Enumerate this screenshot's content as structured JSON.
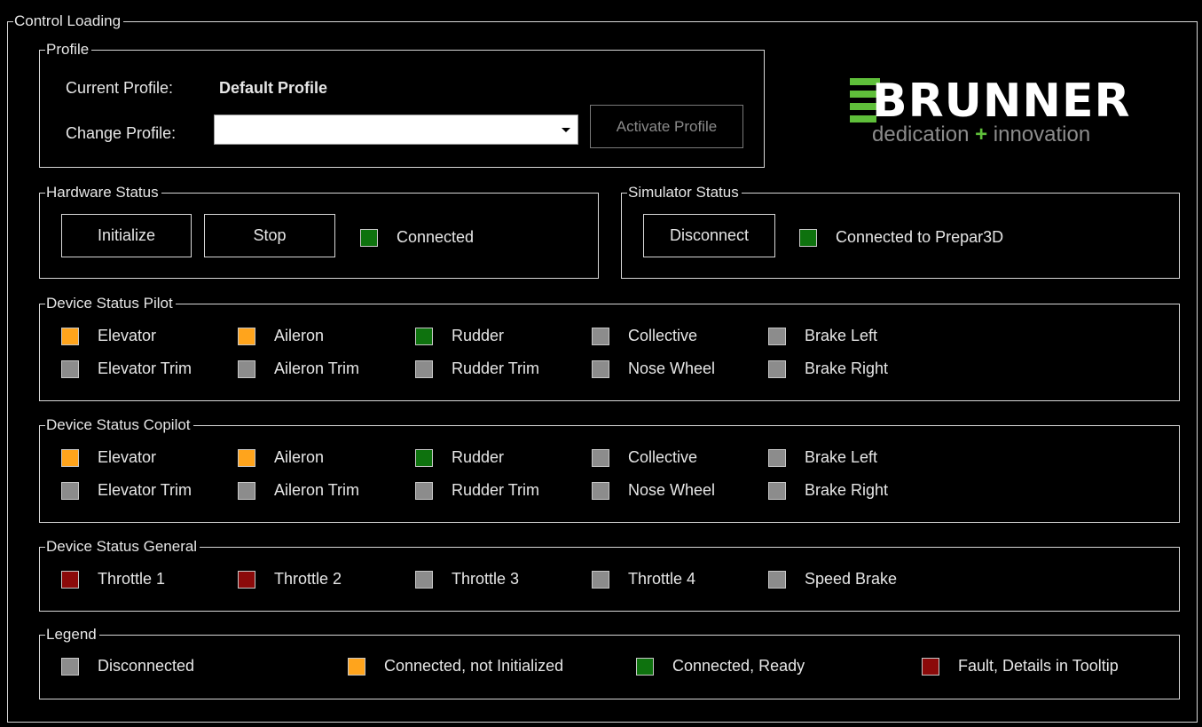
{
  "colors": {
    "disconnected": "#8c8c8c",
    "not_initialized": "#ffa41c",
    "ready": "#0e720e",
    "fault": "#8b0a0a",
    "brand_green": "#5fbf3a"
  },
  "main_group": {
    "title": "Control Loading"
  },
  "profile": {
    "title": "Profile",
    "current_label": "Current Profile:",
    "current_value": "Default Profile",
    "change_label": "Change Profile:",
    "select_value": "",
    "activate_button": "Activate Profile"
  },
  "logo": {
    "brand": "BRUNNER",
    "tagline_left": "dedication",
    "tagline_plus": "+",
    "tagline_right": "innovation"
  },
  "hardware": {
    "title": "Hardware Status",
    "initialize_button": "Initialize",
    "stop_button": "Stop",
    "status_label": "Connected",
    "status": "ready"
  },
  "simulator": {
    "title": "Simulator Status",
    "disconnect_button": "Disconnect",
    "status_label": "Connected to Prepar3D",
    "status": "ready"
  },
  "pilot": {
    "title": "Device Status Pilot",
    "devices": [
      {
        "label": "Elevator",
        "status": "not_initialized"
      },
      {
        "label": "Aileron",
        "status": "not_initialized"
      },
      {
        "label": "Rudder",
        "status": "ready"
      },
      {
        "label": "Collective",
        "status": "disconnected"
      },
      {
        "label": "Brake Left",
        "status": "disconnected"
      },
      {
        "label": "Elevator Trim",
        "status": "disconnected"
      },
      {
        "label": "Aileron Trim",
        "status": "disconnected"
      },
      {
        "label": "Rudder Trim",
        "status": "disconnected"
      },
      {
        "label": "Nose Wheel",
        "status": "disconnected"
      },
      {
        "label": "Brake Right",
        "status": "disconnected"
      }
    ]
  },
  "copilot": {
    "title": "Device Status Copilot",
    "devices": [
      {
        "label": "Elevator",
        "status": "not_initialized"
      },
      {
        "label": "Aileron",
        "status": "not_initialized"
      },
      {
        "label": "Rudder",
        "status": "ready"
      },
      {
        "label": "Collective",
        "status": "disconnected"
      },
      {
        "label": "Brake Left",
        "status": "disconnected"
      },
      {
        "label": "Elevator Trim",
        "status": "disconnected"
      },
      {
        "label": "Aileron Trim",
        "status": "disconnected"
      },
      {
        "label": "Rudder Trim",
        "status": "disconnected"
      },
      {
        "label": "Nose Wheel",
        "status": "disconnected"
      },
      {
        "label": "Brake Right",
        "status": "disconnected"
      }
    ]
  },
  "general": {
    "title": "Device Status General",
    "devices": [
      {
        "label": "Throttle 1",
        "status": "fault"
      },
      {
        "label": "Throttle 2",
        "status": "fault"
      },
      {
        "label": "Throttle 3",
        "status": "disconnected"
      },
      {
        "label": "Throttle 4",
        "status": "disconnected"
      },
      {
        "label": "Speed Brake",
        "status": "disconnected"
      }
    ]
  },
  "legend": {
    "title": "Legend",
    "items": [
      {
        "label": "Disconnected",
        "status": "disconnected"
      },
      {
        "label": "Connected, not Initialized",
        "status": "not_initialized"
      },
      {
        "label": "Connected, Ready",
        "status": "ready"
      },
      {
        "label": "Fault, Details in Tooltip",
        "status": "fault"
      }
    ]
  }
}
